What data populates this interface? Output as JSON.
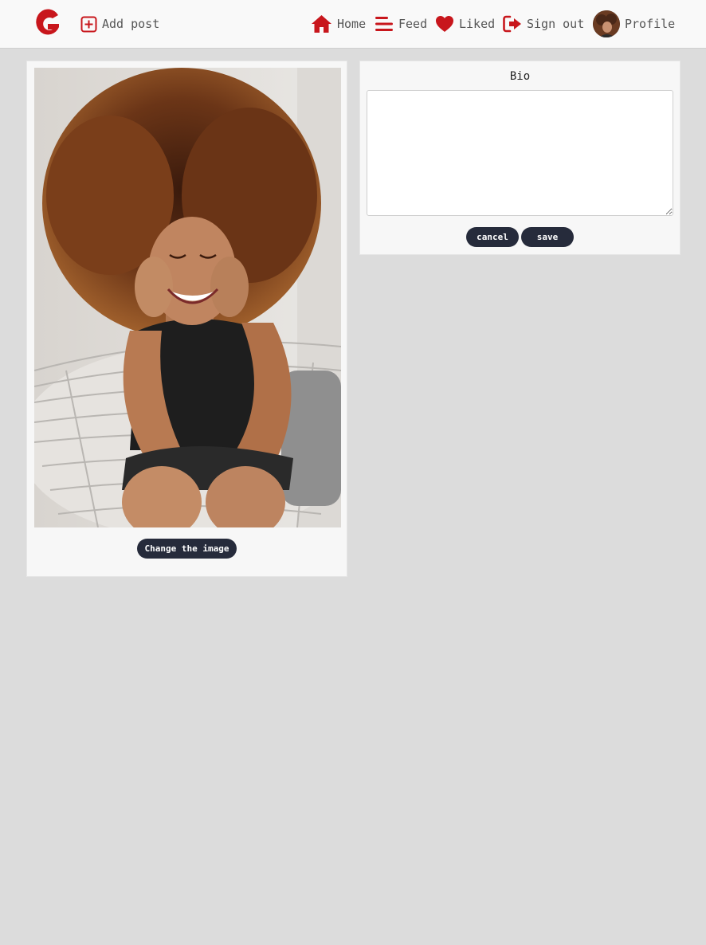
{
  "nav": {
    "logo_letter": "G",
    "add_post": "Add post",
    "home": "Home",
    "feed": "Feed",
    "liked": "Liked",
    "sign_out": "Sign out",
    "profile": "Profile"
  },
  "colors": {
    "accent": "#c8161c",
    "button_bg": "#262b3b",
    "page_bg": "#dcdcdc",
    "card_bg": "#f7f7f7"
  },
  "icons": {
    "add_post": "plus-square-icon",
    "home": "home-icon",
    "feed": "bars-icon",
    "liked": "heart-icon",
    "sign_out": "sign-out-icon"
  },
  "image_card": {
    "change_image_label": "Change the image"
  },
  "bio": {
    "title": "Bio",
    "value": "",
    "cancel_label": "cancel",
    "save_label": "save"
  }
}
